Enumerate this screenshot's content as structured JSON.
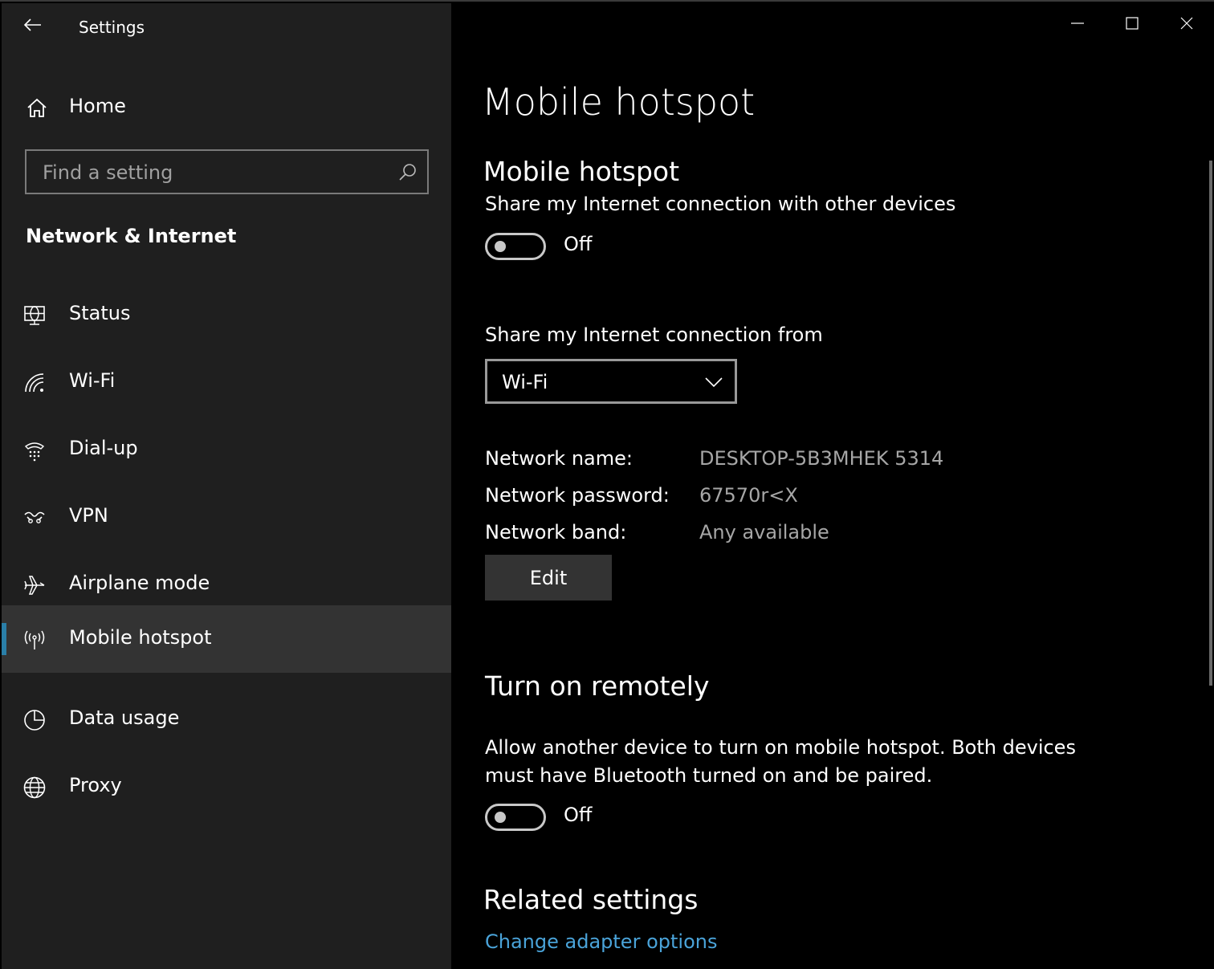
{
  "app": {
    "title": "Settings"
  },
  "sidebar": {
    "home_label": "Home",
    "search_placeholder": "Find a setting",
    "section_heading": "Network & Internet",
    "items": [
      {
        "label": "Status",
        "icon": "globe-monitor-icon"
      },
      {
        "label": "Wi-Fi",
        "icon": "wifi-icon"
      },
      {
        "label": "Dial-up",
        "icon": "dialup-icon"
      },
      {
        "label": "VPN",
        "icon": "vpn-icon"
      },
      {
        "label": "Airplane mode",
        "icon": "airplane-icon"
      },
      {
        "label": "Mobile hotspot",
        "icon": "hotspot-icon",
        "selected": true
      },
      {
        "label": "Data usage",
        "icon": "pie-chart-icon"
      },
      {
        "label": "Proxy",
        "icon": "globe-icon"
      }
    ]
  },
  "main": {
    "page_title": "Mobile hotspot",
    "hotspot": {
      "heading": "Mobile hotspot",
      "description": "Share my Internet connection with other devices",
      "toggle_state": "Off"
    },
    "share_from": {
      "label": "Share my Internet connection from",
      "selected": "Wi-Fi"
    },
    "network": {
      "name_label": "Network name:",
      "name_value": "DESKTOP-5B3MHEK 5314",
      "password_label": "Network password:",
      "password_value": "67570r<X",
      "band_label": "Network band:",
      "band_value": "Any available",
      "edit_label": "Edit"
    },
    "remote": {
      "heading": "Turn on remotely",
      "description": "Allow another device to turn on mobile hotspot. Both devices must have Bluetooth turned on and be paired.",
      "toggle_state": "Off"
    },
    "related": {
      "heading": "Related settings",
      "link": "Change adapter options"
    }
  },
  "colors": {
    "sidebar_bg": "#1f1f1f",
    "content_bg": "#000000",
    "selected_bg": "#333333",
    "accent": "#2a7fa8",
    "link": "#4aa3d9"
  }
}
